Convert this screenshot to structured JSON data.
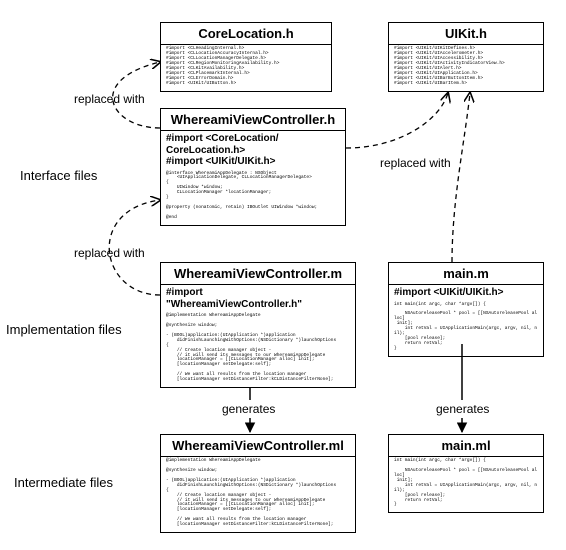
{
  "sections": {
    "interface": "Interface files",
    "implementation": "Implementation files",
    "intermediate": "Intermediate files"
  },
  "edges": {
    "replaced_with_1": "replaced with",
    "replaced_with_2": "replaced with",
    "replaced_with_3": "replaced with",
    "generates_1": "generates",
    "generates_2": "generates"
  },
  "boxes": {
    "corelocation": {
      "title": "CoreLocation.h",
      "body": "#import <CLHeadingInternal.h>\n#import <CLLocationAccuracyInternal.h>\n#import <CLLocationManagerDelegate.h>\n#import <CLRegionMonitoringAvailability.h>\n#import <CLKitAvailability.h>\n#import <CLPlacemarkInternal.h>\n#import <CLErrorDomain.h>\n#import <UIKit/UIButton.h>"
    },
    "uikit": {
      "title": "UIKit.h",
      "body": "#import <UIKit/UIKitDefines.h>\n#import <UIKit/UIAccelerometer.h>\n#import <UIKit/UIAccessibility.h>\n#import <UIKit/UIActivityIndicatorView.h>\n#import <UIKit/UIAlert.h>\n#import <UIKit/UIApplication.h>\n#import <UIKit/UIBarButtonItem.h>\n#import <UIKit/UIBarItem.h>"
    },
    "wvc_h": {
      "title": "WhereamiViewController.h",
      "emph": "#import <CoreLocation/\nCoreLocation.h>\n#import <UIKit/UIKit.h>",
      "body": "@interface WhereamiAppDelegate : NSObject\n    <UIApplicationDelegate, CLLocationManagerDelegate>\n{\n    UIWindow *window;\n    CLLocationManager *locationManager;\n}\n\n@property (nonatomic, retain) IBOutlet UIWindow *window;\n\n@end"
    },
    "wvc_m": {
      "title": "WhereamiViewController.m",
      "emph": "#import\n\"WhereamiViewController.h\"",
      "body": "@implementation WhereamiAppDelegate\n\n@synthesize window;\n\n- (BOOL)application:(UIApplication *)application\n    didFinishLaunchingWithOptions:(NSDictionary *)launchOptions\n{\n    // Create location manager object -\n    // it will send its messages to our WhereamiAppDelegate\n    locationManager = [[CLLocationManager alloc] init];\n    [locationManager setDelegate:self];\n\n    // We want all results from the location manager\n    [locationManager setDistanceFilter:kCLDistanceFilterNone];"
    },
    "main_m": {
      "title": "main.m",
      "emph": "#import <UIKit/UIKit.h>",
      "body": "int main(int argc, char *argv[]) {\n\n    NSAutoreleasePool * pool = [[NSAutoreleasePool alloc]\n init];\n    int retVal = UIApplicationMain(argc, argv, nil, nil);\n    [pool release];\n    return retVal;\n}"
    },
    "wvc_ml": {
      "title": "WhereamiViewController.ml",
      "body": "@implementation WhereamiAppDelegate\n\n@synthesize window;\n\n- (BOOL)application:(UIApplication *)application\n    didFinishLaunchingWithOptions:(NSDictionary *)launchOptions\n{\n    // Create location manager object -\n    // it will send its messages to our WhereamiAppDelegate\n    locationManager = [[CLLocationManager alloc] init];\n    [locationManager setDelegate:self];\n\n    // We want all results from the location manager\n    [locationManager setDistanceFilter:kCLDistanceFilterNone];"
    },
    "main_ml": {
      "title": "main.ml",
      "body": "int main(int argc, char *argv[]) {\n\n    NSAutoreleasePool * pool = [[NSAutoreleasePool alloc]\n init];\n    int retVal = UIApplicationMain(argc, argv, nil, nil);\n    [pool release];\n    return retVal;\n}"
    }
  }
}
